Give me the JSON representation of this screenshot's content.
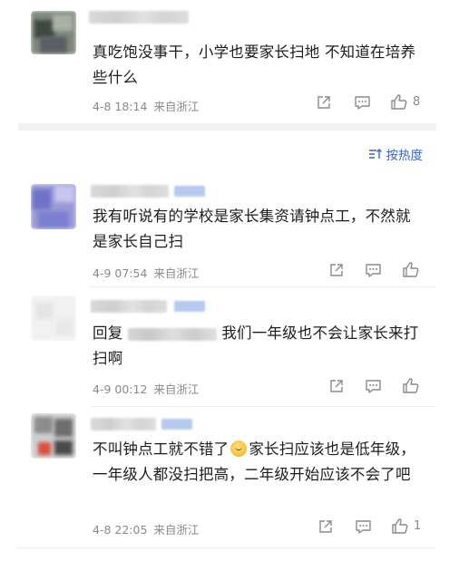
{
  "comments": [
    {
      "text": "真吃饱没事干，小学也要家长扫地 不知道在培养些什么",
      "date": "4-8 18:14",
      "source": "来自浙江",
      "like_count": "8",
      "icons": {
        "share": "share-icon",
        "reply": "comment-icon",
        "like": "thumbs-up-icon"
      }
    },
    {
      "text": "我有听说有的学校是家长集资请钟点工，不然就是家长自己扫",
      "date": "4-9 07:54",
      "source": "来自浙江",
      "like_count": ""
    },
    {
      "reply_prefix": "回复",
      "text": "我们一年级也不会让家长来打扫啊",
      "date": "4-9 00:12",
      "source": "来自浙江",
      "like_count": ""
    },
    {
      "text_before_emoji": "不叫钟点工就不错了",
      "emoji": "thinking-face-emoji",
      "text_after_emoji": "家长扫应该也是低年级，一年级人都没扫把高，二年级开始应该不会了吧",
      "date": "4-8 22:05",
      "source": "来自浙江",
      "like_count": "1"
    }
  ],
  "sort": {
    "label": "按热度",
    "icon": "sort-icon"
  },
  "colors": {
    "link_blue": "#3a64b8",
    "meta_gray": "#8a8a8a",
    "text": "#1c1c1c"
  }
}
